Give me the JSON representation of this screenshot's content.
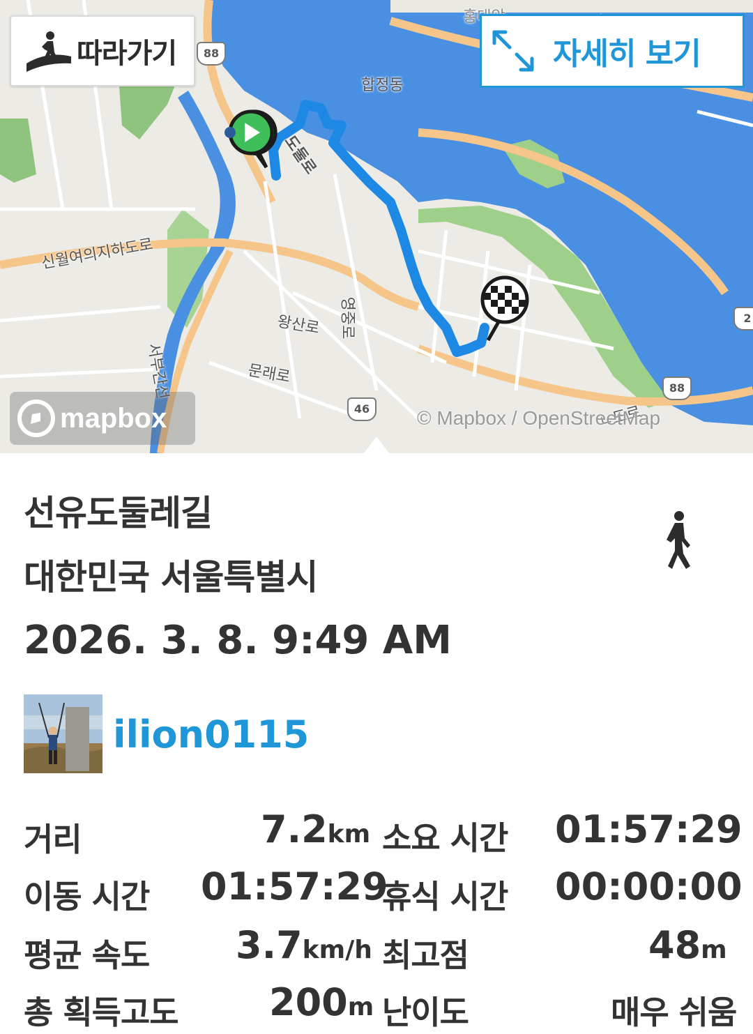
{
  "map": {
    "follow_button": "따라가기",
    "detail_button": "자세히 보기",
    "mapbox_logo": "mapbox",
    "attribution": "© Mapbox / OpenStreetMap",
    "labels": {
      "hapjeong": "합정동",
      "hongdae": "홍대앞",
      "dulle_ro": "도둘로",
      "sinwol": "신월여의지하도로",
      "wangsan": "왕산로",
      "munrae": "문래로",
      "yeongjung": "영중로",
      "seobu": "서부간선",
      "hadoro": "ㄴ도로"
    },
    "shields": {
      "s88a": "88",
      "s88b": "88",
      "s46": "46",
      "s2": "2"
    },
    "colors": {
      "water": "#4a90e2",
      "track": "#1e88e5",
      "road": "#f5c58a",
      "park": "#8bc47a"
    }
  },
  "route": {
    "name": "선유도둘레길",
    "region": "대한민국 서울특별시",
    "datetime": "2026. 3. 8. 9:49 AM",
    "activity_icon": "walking-person-icon"
  },
  "user": {
    "username": "ilion0115"
  },
  "stats": {
    "distance": {
      "label": "거리",
      "value": "7.2",
      "unit": "km"
    },
    "duration": {
      "label": "소요 시간",
      "value": "01:57:29"
    },
    "moving_time": {
      "label": "이동 시간",
      "value": "01:57:29"
    },
    "rest_time": {
      "label": "휴식 시간",
      "value": "00:00:00"
    },
    "avg_speed": {
      "label": "평균 속도",
      "value": "3.7",
      "unit": "km/h"
    },
    "max_elevation": {
      "label": "최고점",
      "value": "48",
      "unit": "m"
    },
    "total_ascent": {
      "label": "총 획득고도",
      "value": "200",
      "unit": "m"
    },
    "difficulty": {
      "label": "난이도",
      "value": "매우 쉬움"
    }
  }
}
